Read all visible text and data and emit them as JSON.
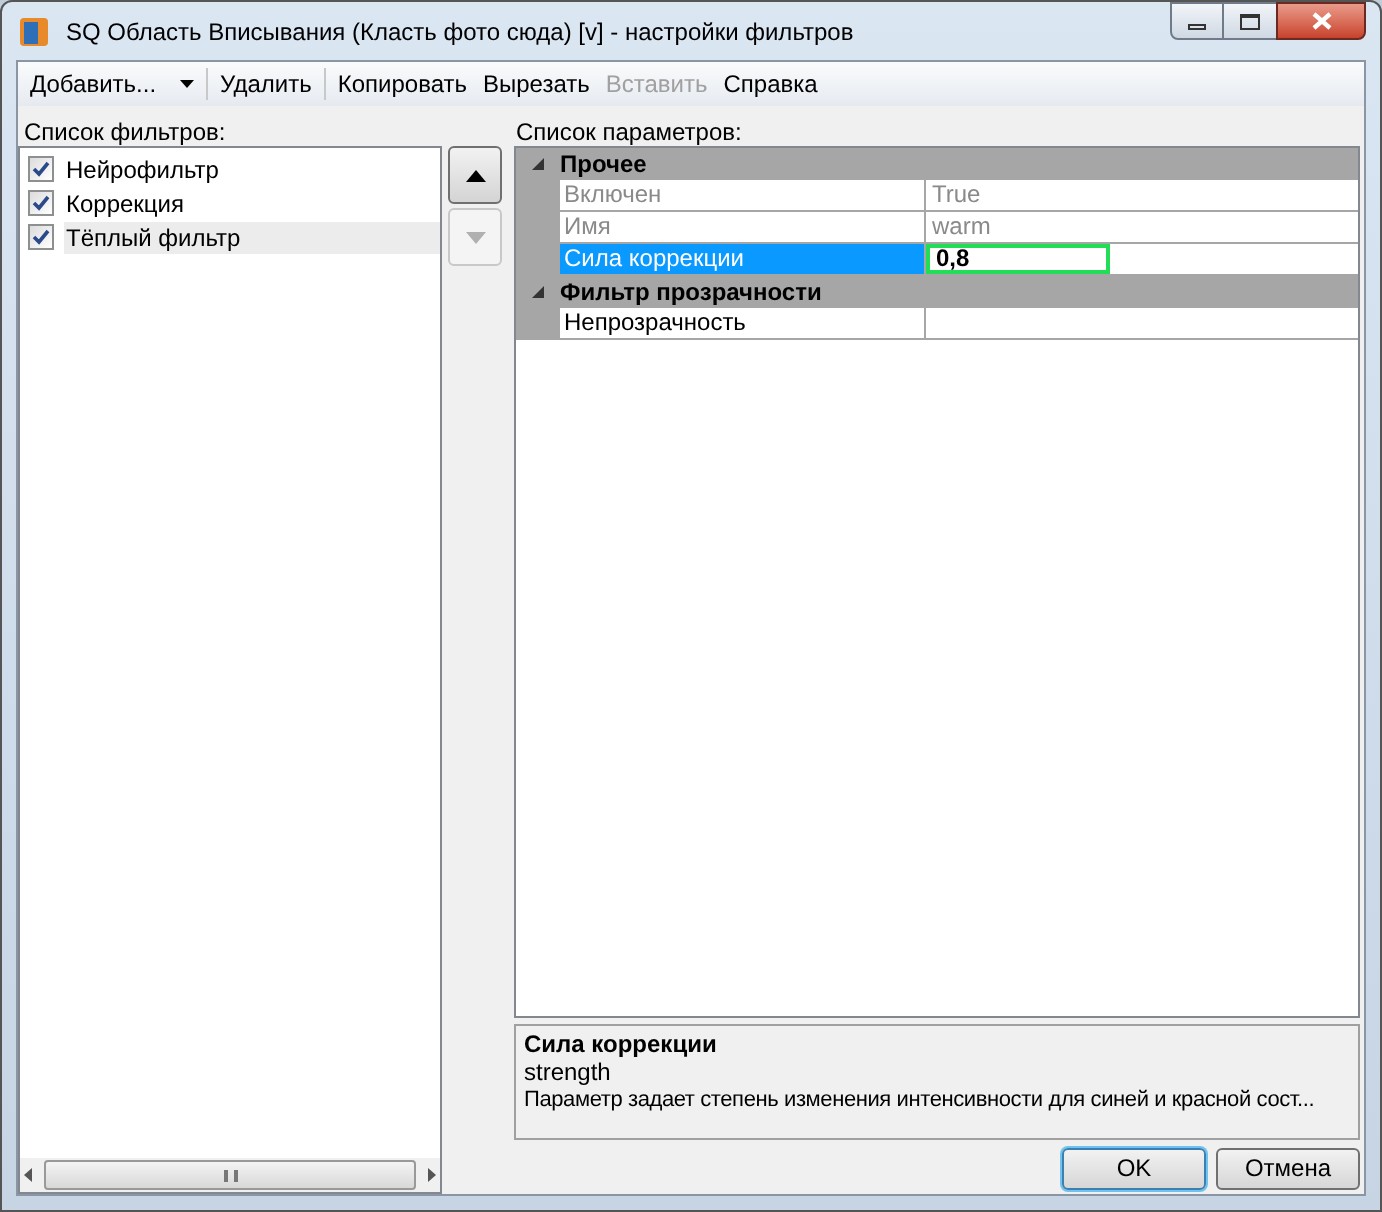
{
  "window": {
    "title": "SQ Область Вписывания (Класть фото сюда) [v] - настройки фильтров"
  },
  "toolbar": [
    {
      "label": "Добавить...",
      "kind": "dropdown",
      "disabled": false
    },
    {
      "label": "Удалить",
      "kind": "button",
      "disabled": false
    },
    {
      "label": "Копировать",
      "kind": "button",
      "disabled": false
    },
    {
      "label": "Вырезать",
      "kind": "button",
      "disabled": false
    },
    {
      "label": "Вставить",
      "kind": "button",
      "disabled": true
    },
    {
      "label": "Справка",
      "kind": "button",
      "disabled": false
    }
  ],
  "filters": {
    "label": "Список фильтров:",
    "items": [
      {
        "name": "Нейрофильтр",
        "checked": true,
        "selected": false
      },
      {
        "name": "Коррекция",
        "checked": true,
        "selected": false
      },
      {
        "name": "Тёплый фильтр",
        "checked": true,
        "selected": true
      }
    ]
  },
  "move_buttons": [
    {
      "kind": "up",
      "disabled": false
    },
    {
      "kind": "down",
      "disabled": true
    }
  ],
  "parameters": {
    "label": "Список параметров:",
    "categories": [
      {
        "name": "Прочее",
        "expanded": true,
        "rows": [
          {
            "name": "Включен",
            "value": "True",
            "disabled": true,
            "selected": false
          },
          {
            "name": "Имя",
            "value": "warm",
            "disabled": true,
            "selected": false
          },
          {
            "name": "Сила коррекции",
            "value": "0,8",
            "disabled": false,
            "selected": true
          }
        ]
      },
      {
        "name": "Фильтр прозрачности",
        "expanded": true,
        "rows": [
          {
            "name": "Непрозрачность",
            "value": "",
            "disabled": false,
            "selected": false
          }
        ]
      }
    ]
  },
  "description": {
    "title": "Сила коррекции",
    "subtitle": "strength",
    "text": "Параметр задает степень изменения интенсивности для синей и красной сост..."
  },
  "buttons": [
    {
      "label": "OK",
      "default": true
    },
    {
      "label": "Отмена",
      "default": false
    }
  ]
}
